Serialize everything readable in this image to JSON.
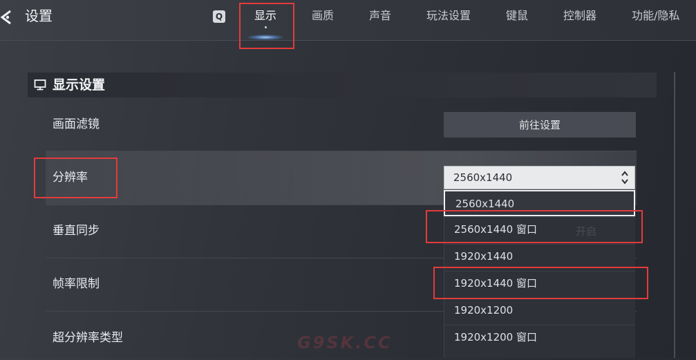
{
  "header": {
    "title": "设置",
    "hotkey": "Q",
    "tabs": [
      {
        "label": "显示",
        "active": true
      },
      {
        "label": "画质"
      },
      {
        "label": "声音"
      },
      {
        "label": "玩法设置"
      },
      {
        "label": "键鼠"
      },
      {
        "label": "控制器"
      },
      {
        "label": "功能/隐私"
      }
    ]
  },
  "section": {
    "title": "显示设置"
  },
  "rows": [
    {
      "label": "画面滤镜",
      "button_label": "前往设置"
    },
    {
      "label": "分辨率",
      "value": "2560x1440"
    },
    {
      "label": "垂直同步"
    },
    {
      "label": "帧率限制"
    },
    {
      "label": "超分辨率类型"
    }
  ],
  "resolution_dropdown": {
    "selected": "2560x1440",
    "options": [
      "2560x1440",
      "2560x1440 窗口",
      "1920x1440",
      "1920x1440 窗口",
      "1920x1200",
      "1920x1200 窗口"
    ]
  },
  "ghost_text": {
    "vsync_value": "开启"
  },
  "watermark": "G9SK.CC",
  "colors": {
    "highlight_box": "#e53b3b",
    "tab_glow": "#aad7ff"
  }
}
